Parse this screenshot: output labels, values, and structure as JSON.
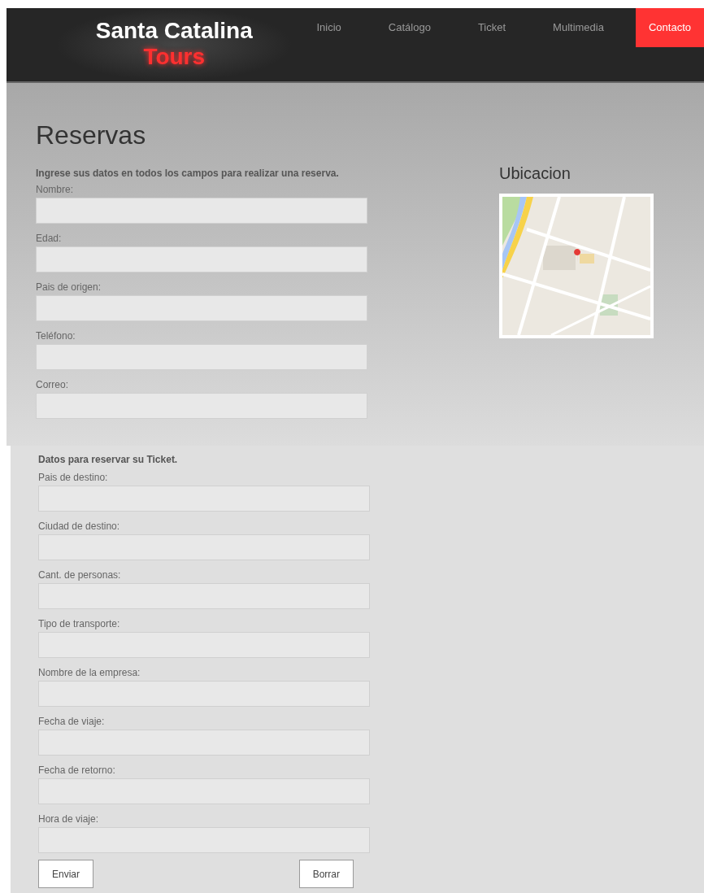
{
  "brand": {
    "title": "Santa Catalina",
    "subtitle": "Tours"
  },
  "nav": [
    {
      "label": "Inicio",
      "selected": false
    },
    {
      "label": "Catálogo",
      "selected": false
    },
    {
      "label": "Ticket",
      "selected": false
    },
    {
      "label": "Multimedia",
      "selected": false
    },
    {
      "label": "Contacto",
      "selected": true
    }
  ],
  "heading": "Reservas",
  "intro": "Ingrese sus datos en todos los campos para realizar una reserva.",
  "personal_fields": [
    {
      "label": "Nombre:"
    },
    {
      "label": "Edad:"
    },
    {
      "label": "Pais de origen:"
    },
    {
      "label": "Teléfono:"
    },
    {
      "label": "Correo:"
    }
  ],
  "location": {
    "title": "Ubicacion"
  },
  "ticket_intro": "Datos para reservar su Ticket.",
  "ticket_fields": [
    {
      "label": "Pais de destino:"
    },
    {
      "label": "Ciudad de destino:"
    },
    {
      "label": "Cant. de personas:"
    },
    {
      "label": "Tipo de transporte:"
    },
    {
      "label": "Nombre de la empresa:"
    },
    {
      "label": "Fecha de viaje:"
    },
    {
      "label": "Fecha de retorno:"
    },
    {
      "label": "Hora de viaje:"
    }
  ],
  "buttons": [
    "Enviar",
    "Borrar"
  ]
}
